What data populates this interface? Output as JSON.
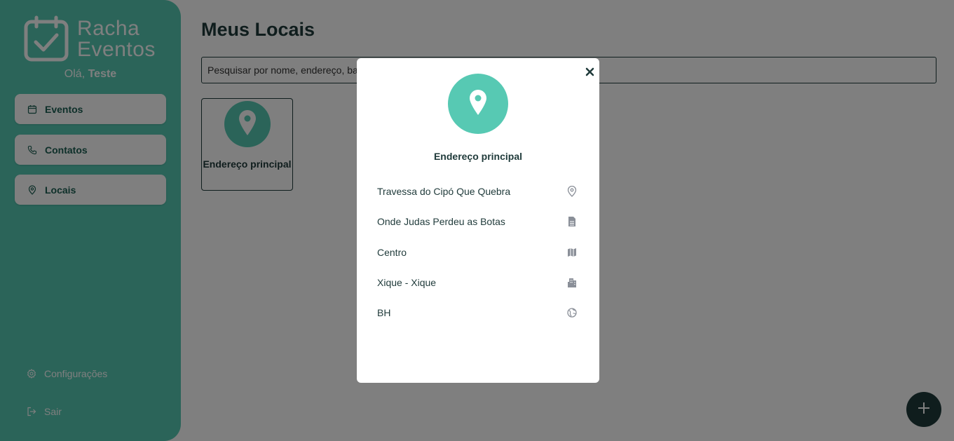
{
  "sidebar": {
    "logo": {
      "line1": "Racha",
      "line2": "Eventos",
      "icon": "calendar-check-icon"
    },
    "greeting_prefix": "Olá,",
    "user_name": "Teste",
    "nav": [
      {
        "label": "Eventos",
        "icon": "calendar-icon"
      },
      {
        "label": "Contatos",
        "icon": "phone-icon"
      },
      {
        "label": "Locais",
        "icon": "map-pin-icon"
      }
    ],
    "settings_label": "Configurações",
    "settings_icon": "gear-icon",
    "logout_label": "Sair",
    "logout_icon": "logout-icon"
  },
  "main": {
    "title": "Meus Locais",
    "search_placeholder": "Pesquisar por nome, endereço, bairro, cidade ou estado",
    "cards": [
      {
        "label": "Endereço principal",
        "icon": "map-pin-icon"
      }
    ],
    "fab_icon": "plus-icon"
  },
  "modal": {
    "title": "Endereço principal",
    "icon": "map-pin-icon",
    "close_icon": "close-icon",
    "details": [
      {
        "value": "Travessa do Cipó Que Quebra",
        "icon": "map-pin-outline-icon"
      },
      {
        "value": "Onde Judas Perdeu as Botas",
        "icon": "document-icon"
      },
      {
        "value": "Centro",
        "icon": "map-icon"
      },
      {
        "value": "Xique - Xique",
        "icon": "city-icon"
      },
      {
        "value": "BH",
        "icon": "globe-icon"
      }
    ]
  },
  "colors": {
    "accent": "#57c9b3",
    "dark": "#1f3a3a",
    "nav_text": "#1b5e52",
    "icon_gray": "#8a8f98"
  }
}
